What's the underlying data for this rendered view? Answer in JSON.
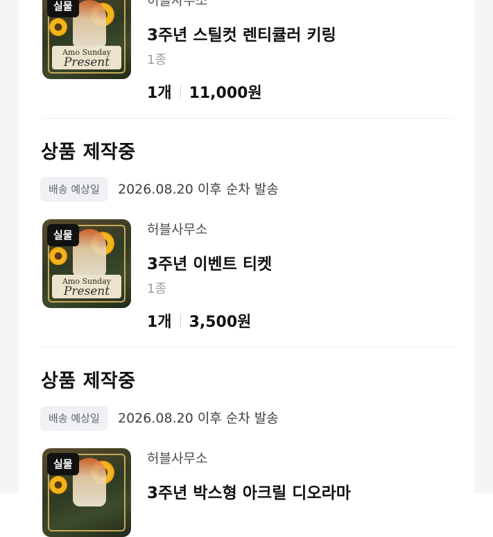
{
  "orders": [
    {
      "product": {
        "badge": "실물",
        "seller": "허블사무소",
        "name": "3주년 스틸컷 렌티큘러 키링",
        "variant": "1종",
        "quantity": "1개",
        "price": "11,000원"
      }
    },
    {
      "section_title": "상품 제작중",
      "ship_label": "배송 예상일",
      "ship_text": "2026.08.20 이후 순차 발송",
      "product": {
        "badge": "실물",
        "seller": "허블사무소",
        "name": "3주년 이벤트 티켓",
        "variant": "1종",
        "quantity": "1개",
        "price": "3,500원"
      }
    },
    {
      "section_title": "상품 제작중",
      "ship_label": "배송 예상일",
      "ship_text": "2026.08.20 이후 순차 발송",
      "product": {
        "badge": "실물",
        "seller": "허블사무소",
        "name": "3주년 박스형 아크릴 디오라마"
      }
    }
  ],
  "thumbnail_text": {
    "line1": "Amo Sunday",
    "line2": "Present"
  },
  "colors": {
    "badge_bg": "#111111",
    "ship_badge_bg": "#f0f1f4",
    "page_gutter": "#f4f5f7"
  }
}
